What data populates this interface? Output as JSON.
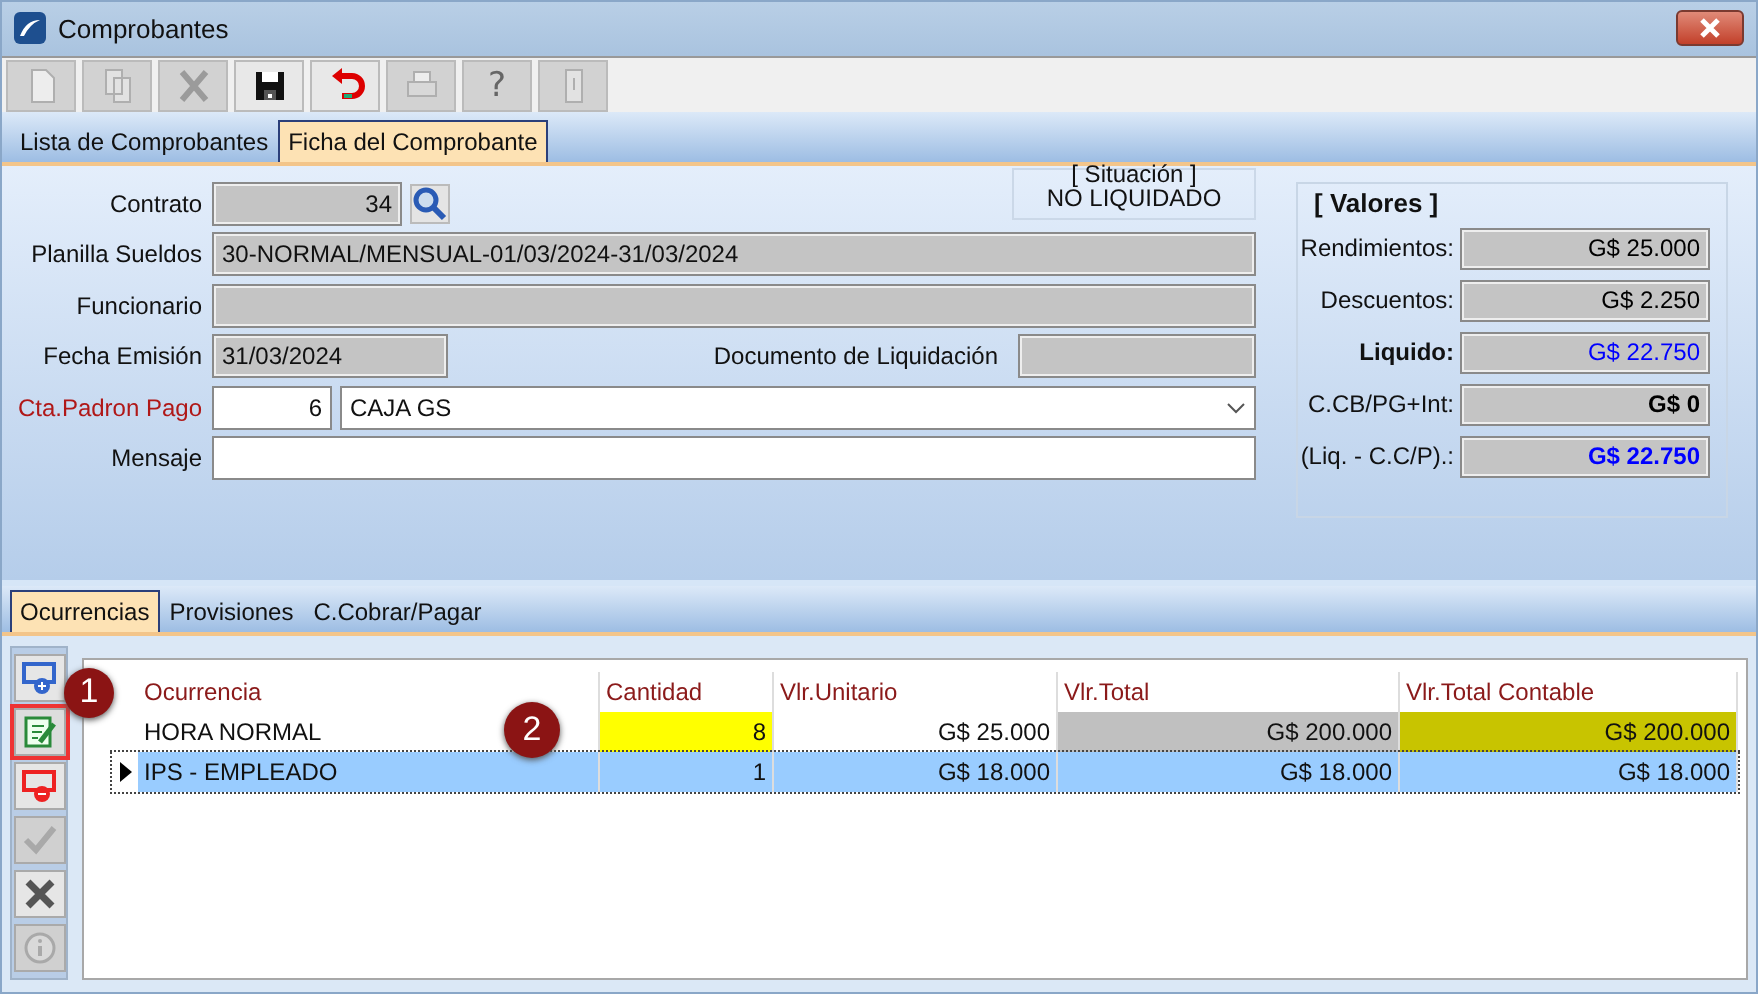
{
  "window": {
    "title": "Comprobantes"
  },
  "toolbar": [
    {
      "kind": "new",
      "disabled": true
    },
    {
      "kind": "copy",
      "disabled": true
    },
    {
      "kind": "delete",
      "disabled": true
    },
    {
      "kind": "save",
      "disabled": false
    },
    {
      "kind": "undo",
      "disabled": false
    },
    {
      "kind": "print",
      "disabled": true
    },
    {
      "kind": "help",
      "disabled": true,
      "glyph": "?"
    },
    {
      "kind": "exit",
      "disabled": true
    }
  ],
  "tabs": [
    {
      "label": "Lista de Comprobantes",
      "selected": false
    },
    {
      "label": "Ficha del Comprobante",
      "selected": true
    }
  ],
  "form": {
    "contrato": {
      "label": "Contrato",
      "value": "34"
    },
    "planilla": {
      "label": "Planilla Sueldos",
      "value": "30-NORMAL/MENSUAL-01/03/2024-31/03/2024"
    },
    "funcionario": {
      "label": "Funcionario"
    },
    "fecha": {
      "label": "Fecha Emisión",
      "value": "31/03/2024"
    },
    "documento": {
      "label": "Documento de Liquidación"
    },
    "cuenta": {
      "label": "Cta.Padron Pago",
      "code": "6",
      "value": "CAJA GS"
    },
    "mensaje": {
      "label": "Mensaje"
    },
    "situacion": {
      "title": "[ Situación ]",
      "value": "NO LIQUIDADO"
    }
  },
  "valores": {
    "title": "[ Valores ]",
    "items": [
      {
        "label": "Rendimientos:",
        "value": "G$ 25.000",
        "color": "#000000",
        "label_bold": false,
        "value_bold": false
      },
      {
        "label": "Descuentos:",
        "value": "G$ 2.250",
        "color": "#000000",
        "label_bold": false,
        "value_bold": false
      },
      {
        "label": "Liquido:",
        "value": "G$ 22.750",
        "color": "#0000ff",
        "label_bold": true,
        "value_bold": false
      },
      {
        "label": "C.CB/PG+Int:",
        "value": "G$ 0",
        "color": "#000000",
        "label_bold": false,
        "value_bold": true
      },
      {
        "label": "(Liq. - C.C/P).:",
        "value": "G$ 22.750",
        "color": "#0000ff",
        "label_bold": false,
        "value_bold": true
      }
    ]
  },
  "detail_tabs": [
    {
      "label": "Ocurrencias",
      "selected": true
    },
    {
      "label": "Provisiones",
      "selected": false
    },
    {
      "label": "C.Cobrar/Pagar",
      "selected": false
    }
  ],
  "side_toolbar": [
    {
      "kind": "add",
      "disabled": false,
      "highlighted": false
    },
    {
      "kind": "edit",
      "disabled": false,
      "highlighted": true
    },
    {
      "kind": "remove",
      "disabled": false,
      "highlighted": false
    },
    {
      "kind": "confirm",
      "disabled": true,
      "highlighted": false
    },
    {
      "kind": "cancel",
      "disabled": false,
      "highlighted": false
    },
    {
      "kind": "info",
      "disabled": true,
      "highlighted": false
    }
  ],
  "table": {
    "columns": [
      "Ocurrencia",
      "Cantidad",
      "Vlr.Unitario",
      "Vlr.Total",
      "Vlr.Total Contable"
    ],
    "rows": [
      {
        "selected": false,
        "cells": [
          {
            "text": "HORA NORMAL",
            "color": "#ffffff"
          },
          {
            "text": "8",
            "color": "#ffff00"
          },
          {
            "text": "G$ 25.000",
            "color": "#ffffff"
          },
          {
            "text": "G$ 200.000",
            "color": "#c0c0c0"
          },
          {
            "text": "G$ 200.000",
            "color": "#c8c400"
          }
        ]
      },
      {
        "selected": true,
        "cells": [
          {
            "text": "IPS - EMPLEADO",
            "color": "#99ccff"
          },
          {
            "text": "1",
            "color": "#99ccff"
          },
          {
            "text": "G$ 18.000",
            "color": "#99ccff"
          },
          {
            "text": "G$ 18.000",
            "color": "#99ccff"
          },
          {
            "text": "G$ 18.000",
            "color": "#99ccff"
          }
        ]
      }
    ]
  },
  "callouts": [
    "1",
    "2"
  ]
}
